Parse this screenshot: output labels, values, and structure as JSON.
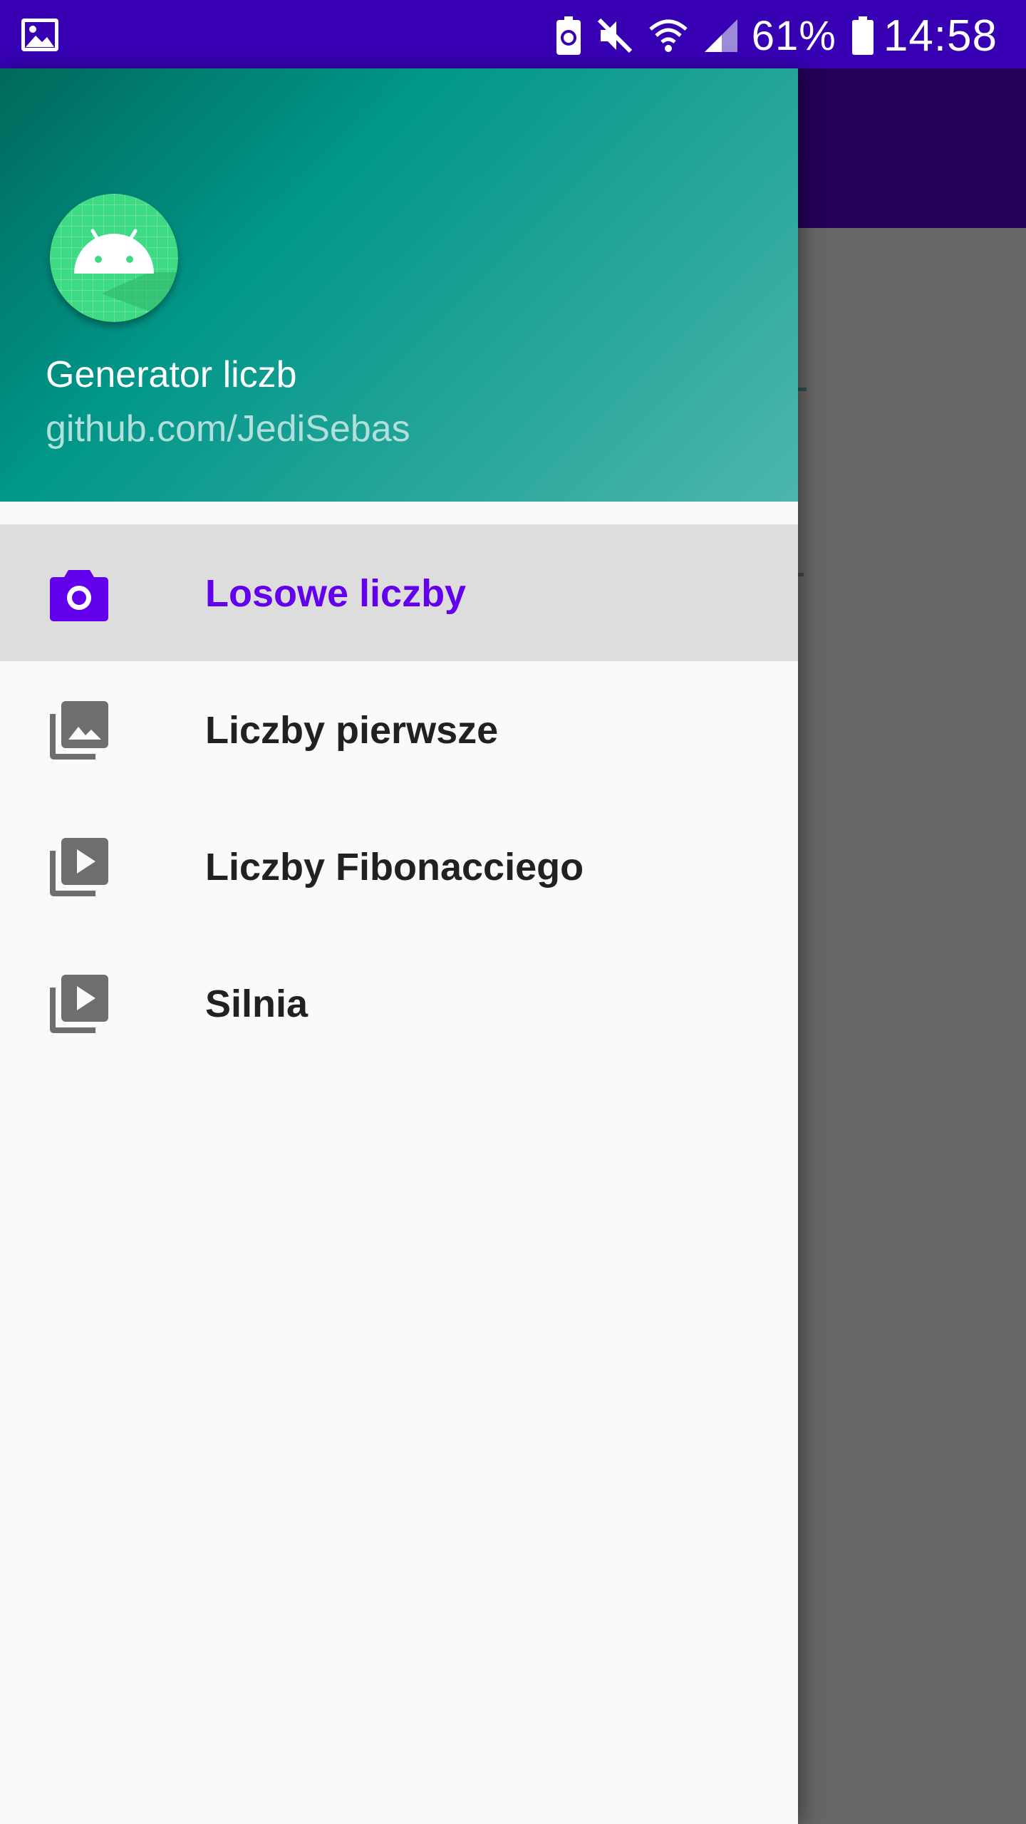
{
  "status_bar": {
    "icons": [
      "image-icon",
      "battery-saver-icon",
      "mute-icon",
      "wifi-icon",
      "signal-icon",
      "battery-icon"
    ],
    "battery_percent": "61%",
    "time": "14:58"
  },
  "drawer": {
    "header": {
      "avatar_icon": "android-icon",
      "title": "Generator liczb",
      "subtitle": "github.com/JediSebas"
    },
    "items": [
      {
        "label": "Losowe liczby",
        "icon": "camera-icon",
        "selected": true
      },
      {
        "label": "Liczby pierwsze",
        "icon": "photo-library-icon",
        "selected": false
      },
      {
        "label": "Liczby Fibonacciego",
        "icon": "video-library-icon",
        "selected": false
      },
      {
        "label": "Silnia",
        "icon": "video-library-icon",
        "selected": false
      }
    ]
  },
  "colors": {
    "status_bar": "#3700b3",
    "toolbar": "#240058",
    "header_start": "#00695c",
    "header_end": "#4db6ac",
    "selected_accent": "#6200ee",
    "selected_background": "#dddddd",
    "scrim": "#666666"
  }
}
